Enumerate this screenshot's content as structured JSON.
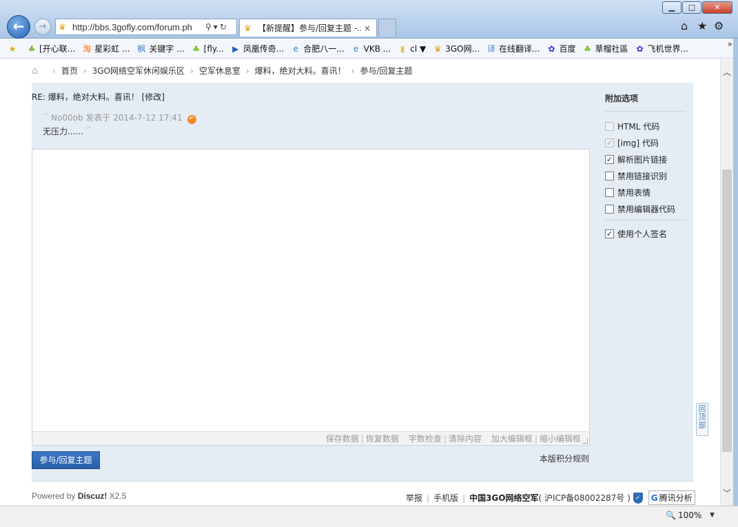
{
  "browser": {
    "address": "http://bbs.3gofly.com/forum.ph",
    "tab_title": "【新提醒】参与/回复主题 -...",
    "tab_close": "×",
    "back": "←",
    "forward": "→",
    "minimize": "▁",
    "maximize": "□",
    "close": "✕",
    "more_favorites": "»",
    "zoom": "100%"
  },
  "favorites": [
    {
      "label": "[开心联...",
      "icon": "grass-icon",
      "glyph": "♣",
      "color": "#7cbf2e"
    },
    {
      "label": "星彩虹 ...",
      "icon": "taobao-icon",
      "glyph": "淘",
      "color": "#ff6a00"
    },
    {
      "label": "关键字 ...",
      "icon": "page-icon",
      "glyph": "枫",
      "color": "#3a7fc8"
    },
    {
      "label": "[fly...",
      "icon": "grass-icon",
      "glyph": "♣",
      "color": "#7cbf2e"
    },
    {
      "label": "凤凰传奇...",
      "icon": "media-icon",
      "glyph": "▶",
      "color": "#2d62b5"
    },
    {
      "label": "合肥八一...",
      "icon": "ie-page-icon",
      "glyph": "e",
      "color": "#2d8ad8"
    },
    {
      "label": "VKB ...",
      "icon": "ie-page-icon",
      "glyph": "e",
      "color": "#2d8ad8"
    },
    {
      "label": "cl ▼",
      "icon": "folder-icon",
      "glyph": "▮",
      "color": "#e8c24a"
    },
    {
      "label": "3GO网...",
      "icon": "trophy-icon",
      "glyph": "♛",
      "color": "#d8a21f"
    },
    {
      "label": "在线翻译...",
      "icon": "translate-icon",
      "glyph": "译",
      "color": "#4a8ad6"
    },
    {
      "label": "百度",
      "icon": "baidu-icon",
      "glyph": "✿",
      "color": "#2932e1"
    },
    {
      "label": "草榴社區",
      "icon": "grass-icon",
      "glyph": "♣",
      "color": "#7cbf2e"
    },
    {
      "label": "飞机世界...",
      "icon": "baidu-icon",
      "glyph": "✿",
      "color": "#2932e1"
    }
  ],
  "breadcrumb": [
    "首页",
    "3GO网络空军休闲娱乐区",
    "空军休息室",
    "爆料，绝对大料。喜讯！",
    "参与/回复主题"
  ],
  "post": {
    "title": "RE: 爆料，绝对大料。喜讯！ [修改]",
    "quote_author": "No00ob 发表于 2014-7-12 17:41",
    "quote_text": "无压力......",
    "open_quote": "“",
    "close_quote": "”"
  },
  "editor_tools": [
    "保存数据",
    "恢复数据",
    "字数检查",
    "清除内容",
    "加大编辑框",
    "缩小编辑框"
  ],
  "sidebar": {
    "title": "附加选项",
    "options": [
      {
        "label": "HTML 代码",
        "checked": false,
        "disabled": true
      },
      {
        "label": "[img] 代码",
        "checked": true,
        "disabled": true
      },
      {
        "label": "解析图片链接",
        "checked": true,
        "disabled": false
      },
      {
        "label": "禁用链接识别",
        "checked": false,
        "disabled": false
      },
      {
        "label": "禁用表情",
        "checked": false,
        "disabled": false
      },
      {
        "label": "禁用编辑器代码",
        "checked": false,
        "disabled": false
      }
    ],
    "signature": {
      "label": "使用个人签名",
      "checked": true,
      "disabled": false
    }
  },
  "actions": {
    "submit": "参与/回复主题",
    "rules": "本版积分规则",
    "back_to_top": "回顶部"
  },
  "footer": {
    "powered_prefix": "Powered by",
    "powered_brand": "Discuz!",
    "powered_version": "X2.5",
    "links": [
      "举报",
      "手机版"
    ],
    "site_name": "中国3GO网络空军",
    "icp": "( 沪ICP备08002287号 )",
    "tencent": "腾讯分析"
  }
}
